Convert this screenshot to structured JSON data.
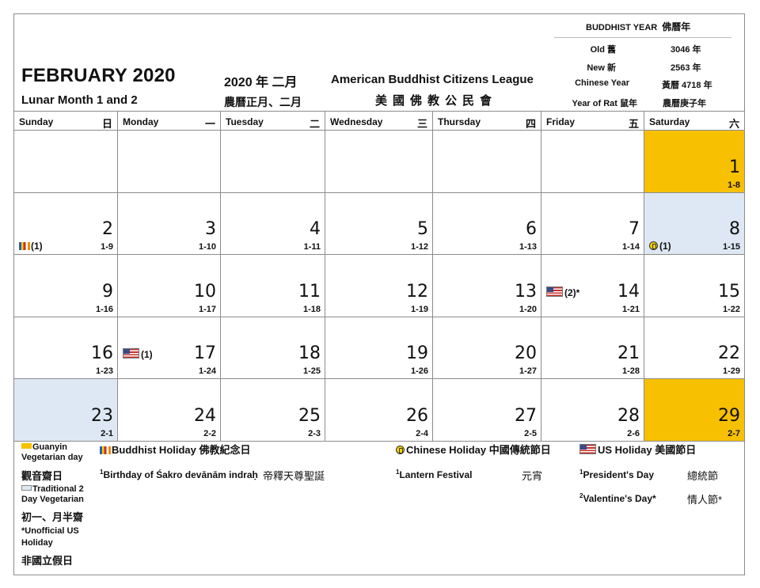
{
  "header": {
    "title": "FEBRUARY 2020",
    "subtitle": "Lunar Month 1 and 2",
    "year_month_zh": "2020 年 二月",
    "lunar_month_zh": "農曆正月、二月",
    "org_name": "American Buddhist Citizens League",
    "org_name_zh": "美國佛教公民會"
  },
  "year_info": {
    "heading": "BUDDHIST YEAR",
    "heading_zh": "佛曆年",
    "rows": [
      {
        "label": "Old 舊",
        "value": "3046 年"
      },
      {
        "label": "New 新",
        "value": "2563 年"
      },
      {
        "label": "Chinese Year",
        "value": "黃曆 4718 年"
      },
      {
        "label": "Year of Rat 鼠年",
        "value": "農曆庚子年"
      }
    ]
  },
  "weekdays": [
    {
      "en": "Sunday",
      "zh": "日"
    },
    {
      "en": "Monday",
      "zh": "一"
    },
    {
      "en": "Tuesday",
      "zh": "二"
    },
    {
      "en": "Wednesday",
      "zh": "三"
    },
    {
      "en": "Thursday",
      "zh": "四"
    },
    {
      "en": "Friday",
      "zh": "五"
    },
    {
      "en": "Saturday",
      "zh": "六"
    }
  ],
  "weeks": [
    [
      null,
      null,
      null,
      null,
      null,
      null,
      {
        "day": "1",
        "lunar": "1-8",
        "shade": "gold"
      }
    ],
    [
      {
        "day": "2",
        "lunar": "1-9",
        "mark": "(1)",
        "icon": "buddhist-flag-icon"
      },
      {
        "day": "3",
        "lunar": "1-10"
      },
      {
        "day": "4",
        "lunar": "1-11"
      },
      {
        "day": "5",
        "lunar": "1-12"
      },
      {
        "day": "6",
        "lunar": "1-13"
      },
      {
        "day": "7",
        "lunar": "1-14"
      },
      {
        "day": "8",
        "lunar": "1-15",
        "shade": "blue",
        "mark": "(1)",
        "icon": "chinese-holiday-icon"
      }
    ],
    [
      {
        "day": "9",
        "lunar": "1-16"
      },
      {
        "day": "10",
        "lunar": "1-17"
      },
      {
        "day": "11",
        "lunar": "1-18"
      },
      {
        "day": "12",
        "lunar": "1-19"
      },
      {
        "day": "13",
        "lunar": "1-20"
      },
      {
        "day": "14",
        "lunar": "1-21",
        "mark": "(2)*",
        "icon": "us-flag-icon"
      },
      {
        "day": "15",
        "lunar": "1-22"
      }
    ],
    [
      {
        "day": "16",
        "lunar": "1-23"
      },
      {
        "day": "17",
        "lunar": "1-24",
        "mark": "(1)",
        "icon": "us-flag-icon"
      },
      {
        "day": "18",
        "lunar": "1-25"
      },
      {
        "day": "19",
        "lunar": "1-26"
      },
      {
        "day": "20",
        "lunar": "1-27"
      },
      {
        "day": "21",
        "lunar": "1-28"
      },
      {
        "day": "22",
        "lunar": "1-29"
      }
    ],
    [
      {
        "day": "23",
        "lunar": "2-1",
        "shade": "blue"
      },
      {
        "day": "24",
        "lunar": "2-2"
      },
      {
        "day": "25",
        "lunar": "2-3"
      },
      {
        "day": "26",
        "lunar": "2-4"
      },
      {
        "day": "27",
        "lunar": "2-5"
      },
      {
        "day": "28",
        "lunar": "2-6"
      },
      {
        "day": "29",
        "lunar": "2-7",
        "shade": "gold"
      }
    ]
  ],
  "legend": {
    "guanyin_en": "Guanyin Vegetarian day",
    "guanyin_zh": "觀音齋日",
    "traditional_en": "Traditional 2 Day Vegetarian",
    "traditional_zh": "初一、月半齋",
    "unofficial_en": "*Unofficial US Holiday",
    "unofficial_zh": "非國立假日",
    "buddhist_heading": "Buddhist Holiday 佛教紀念日",
    "buddhist_item_en": "Birthday of Śakro devānām indraḥ",
    "buddhist_item_zh": "帝釋天尊聖誕",
    "chinese_heading": "Chinese Holiday 中國傳統節日",
    "chinese_item_en": "Lantern Festival",
    "chinese_item_zh": "元宵",
    "us_heading": "US Holiday 美國節日",
    "us_item1_en": "President's Day",
    "us_item1_zh": "總統節",
    "us_item2_en": "Valentine's Day*",
    "us_item2_zh": "情人節*"
  },
  "colors": {
    "gold": "#f7c000",
    "light_blue": "#dde8f4"
  }
}
